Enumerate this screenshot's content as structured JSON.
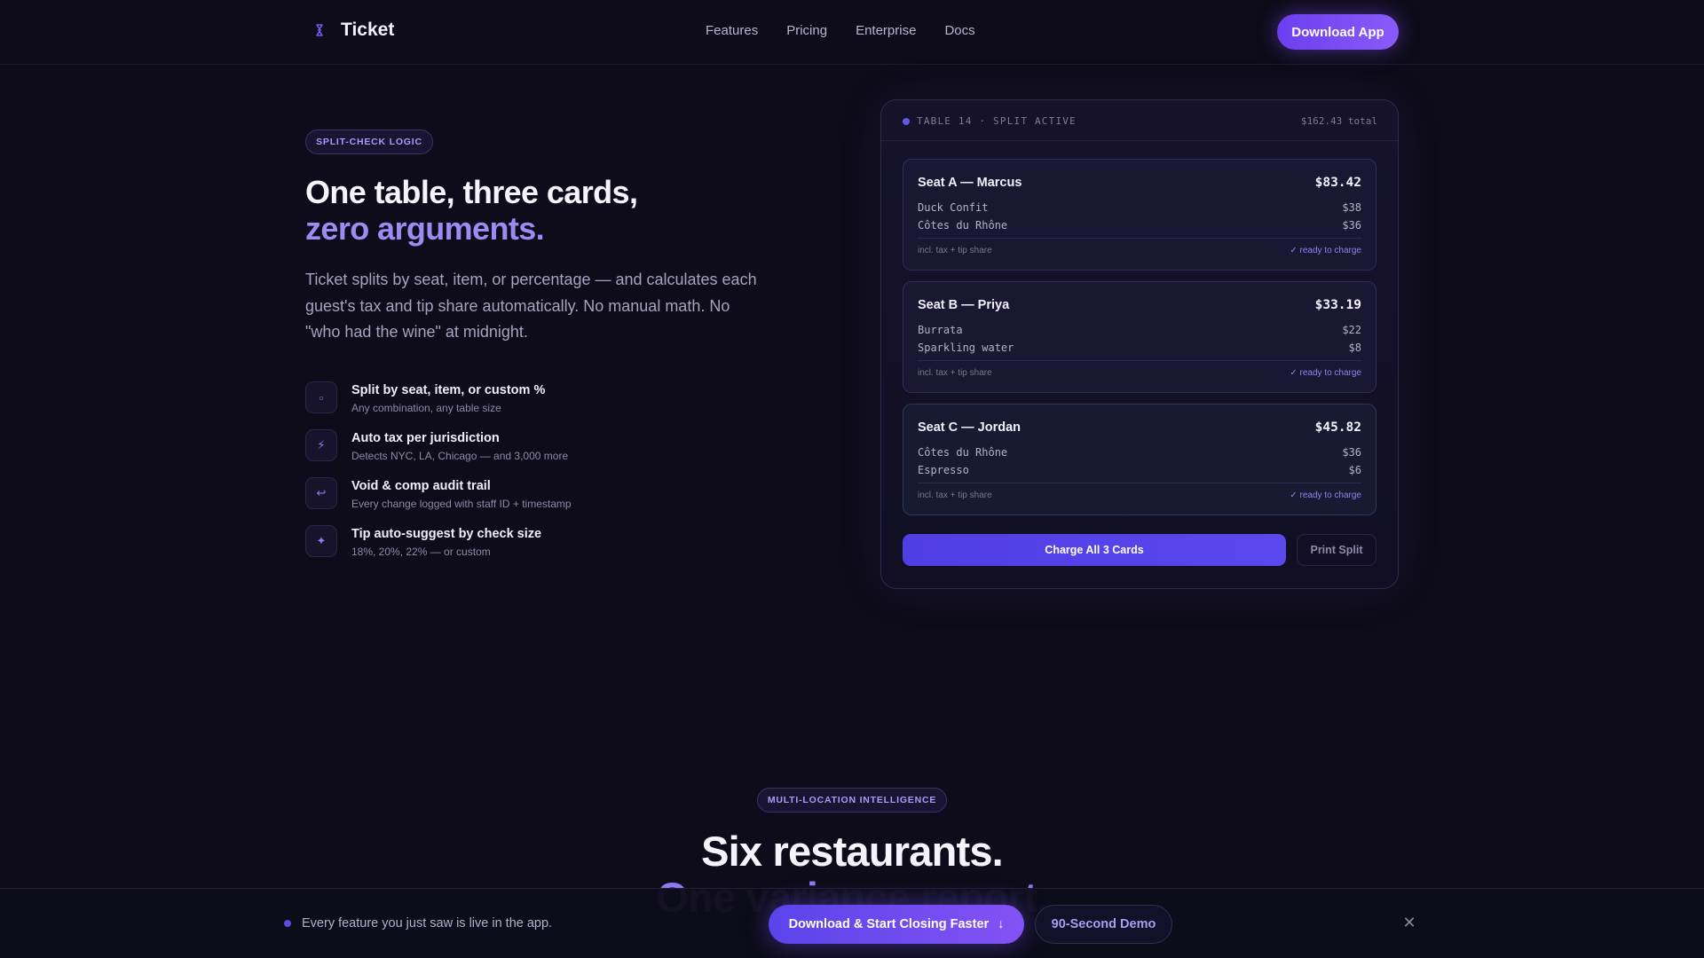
{
  "nav": {
    "brand_icon": "ticket-logo-icon",
    "brand": "Ticket",
    "links": [
      "Features",
      "Pricing",
      "Enterprise",
      "Docs"
    ],
    "cta": "Download App"
  },
  "hero": {
    "badge": "SPLIT-CHECK LOGIC",
    "title_line1": "One table, three cards,",
    "title_line2": "zero arguments.",
    "description": "Ticket splits by seat, item, or percentage — and calculates each guest's tax and tip share automatically. No manual math. No \"who had the wine\" at midnight.",
    "features": [
      {
        "icon": "▫",
        "title": "Split by seat, item, or custom %",
        "subtitle": "Any combination, any table size"
      },
      {
        "icon": "⚡",
        "title": "Auto tax per jurisdiction",
        "subtitle": "Detects NYC, LA, Chicago — and 3,000 more"
      },
      {
        "icon": "↩",
        "title": "Void & comp audit trail",
        "subtitle": "Every change logged with staff ID + timestamp"
      },
      {
        "icon": "✦",
        "title": "Tip auto-suggest by check size",
        "subtitle": "18%, 20%, 22% — or custom"
      }
    ]
  },
  "panel": {
    "label": "TABLE 14 · SPLIT ACTIVE",
    "total": "$162.43 total",
    "seats": [
      {
        "name": "Seat A — Marcus",
        "amount": "$83.42",
        "items": [
          {
            "item": "Duck Confit",
            "price": "$38"
          },
          {
            "item": "Côtes du Rhône",
            "price": "$36"
          }
        ],
        "note": "incl. tax + tip share",
        "status": "✓ ready to charge"
      },
      {
        "name": "Seat B — Priya",
        "amount": "$33.19",
        "items": [
          {
            "item": "Burrata",
            "price": "$22"
          },
          {
            "item": "Sparkling water",
            "price": "$8"
          }
        ],
        "note": "incl. tax + tip share",
        "status": "✓ ready to charge"
      },
      {
        "name": "Seat C — Jordan",
        "amount": "$45.82",
        "items": [
          {
            "item": "Côtes du Rhône",
            "price": "$36"
          },
          {
            "item": "Espresso",
            "price": "$6"
          }
        ],
        "note": "incl. tax + tip share",
        "status": "✓ ready to charge"
      }
    ],
    "charge_button": "Charge All 3 Cards",
    "print_button": "Print Split"
  },
  "section2": {
    "badge": "MULTI-LOCATION INTELLIGENCE",
    "title_line1": "Six restaurants.",
    "title_line2": "One variance report."
  },
  "bottom_bar": {
    "message": "Every feature you just saw is live in the app.",
    "primary": "Download & Start Closing Faster",
    "primary_icon": "↓",
    "secondary": "90-Second Demo",
    "close": "✕"
  },
  "colors": {
    "background": "#0e0c1a",
    "accent": "#6c3ef0",
    "accent_text": "#9d8af2"
  }
}
